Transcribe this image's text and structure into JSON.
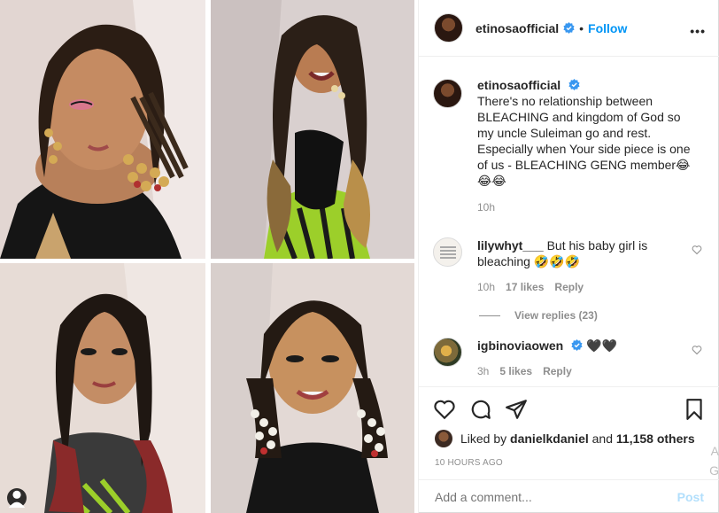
{
  "post": {
    "author": "etinosaofficial",
    "follow_label": "Follow",
    "separator": "•",
    "more_label": "•••",
    "caption": {
      "author": "etinosaofficial",
      "text": "There's no relationship between BLEACHING and kingdom of God so my uncle Suleiman go and rest. Especially when Your side piece is one of us - BLEACHING GENG member😂😂😂",
      "time": "10h"
    },
    "comments": [
      {
        "author": "lilywhyt___",
        "text": "But his baby girl is bleaching 🤣🤣🤣",
        "time": "10h",
        "likes": "17 likes",
        "reply_label": "Reply",
        "view_replies": "View replies (23)"
      },
      {
        "author": "igbinoviaowen",
        "text": "🖤🖤",
        "time": "3h",
        "likes": "5 likes",
        "reply_label": "Reply"
      }
    ],
    "liked_by": {
      "prefix": "Liked by",
      "user": "danielkdaniel",
      "joiner": "and",
      "others": "11,158 others"
    },
    "timestamp": "10 HOURS AGO",
    "add_comment_placeholder": "Add a comment...",
    "post_label": "Post",
    "edge_text": "A G"
  },
  "icons": {
    "verified": "verified-badge-icon",
    "heart": "heart-icon",
    "comment": "comment-icon",
    "share": "share-icon",
    "save": "bookmark-icon",
    "user_tag": "user-tag-icon"
  },
  "colors": {
    "accent": "#0095f6",
    "muted": "#8e8e8e",
    "border": "#efefef",
    "text": "#262626"
  }
}
